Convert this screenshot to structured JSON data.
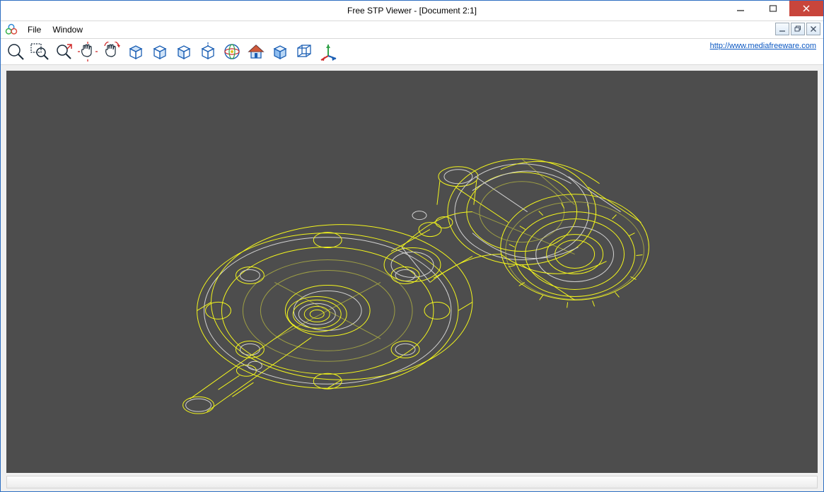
{
  "window": {
    "title": "Free STP Viewer - [Document 2:1]"
  },
  "menu": {
    "file": "File",
    "window": "Window"
  },
  "link": {
    "url_text": "http://www.mediafreeware.com"
  },
  "tools": [
    {
      "name": "zoom-in",
      "label": "Zoom In"
    },
    {
      "name": "zoom-window",
      "label": "Zoom Window"
    },
    {
      "name": "zoom-dynamic",
      "label": "Dynamic Zoom"
    },
    {
      "name": "pan",
      "label": "Pan"
    },
    {
      "name": "rotate",
      "label": "Rotate"
    },
    {
      "name": "view-top",
      "label": "Top View"
    },
    {
      "name": "view-bottom",
      "label": "Bottom View"
    },
    {
      "name": "view-front",
      "label": "Front View"
    },
    {
      "name": "view-back",
      "label": "Back View"
    },
    {
      "name": "view-global",
      "label": "Global View"
    },
    {
      "name": "view-home",
      "label": "Home View"
    },
    {
      "name": "shade-wireframe",
      "label": "Shade / Wireframe"
    },
    {
      "name": "perspective",
      "label": "Perspective"
    },
    {
      "name": "axes",
      "label": "Axes"
    }
  ],
  "mdi": {
    "min": "–",
    "restore": "❐",
    "close": "×"
  },
  "viewport": {
    "background": "#4d4d4d",
    "wire_color_primary": "#fcff1a",
    "wire_color_secondary": "#dadada",
    "model_description": "STEP wireframe: flanged shaft assembly with large bolted flange, central shaft/hub, and cylindrical instrument housing"
  }
}
